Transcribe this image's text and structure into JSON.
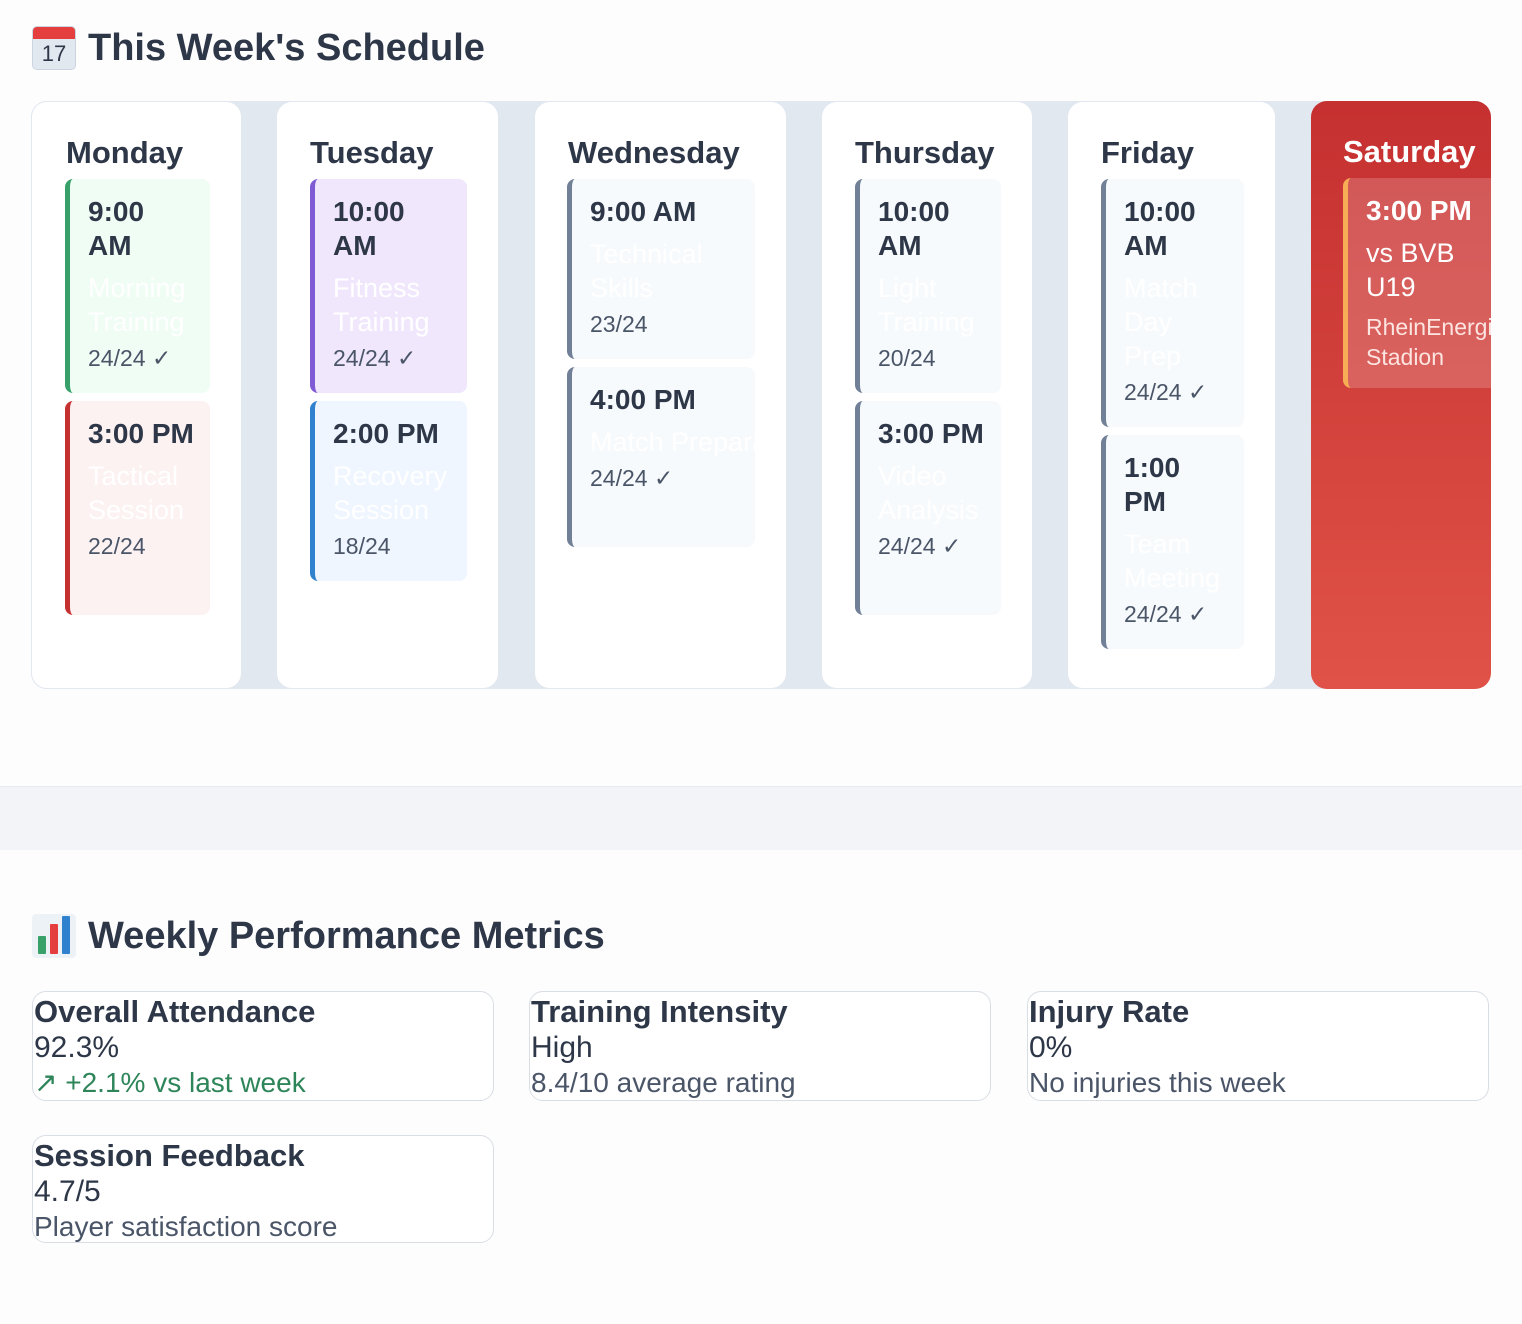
{
  "schedule": {
    "title": "This Week's Schedule",
    "icon": "calendar-icon",
    "icon_text": "17",
    "days": [
      {
        "name": "Monday",
        "sessions": [
          {
            "time": "9:00 AM",
            "title": "Morning Training",
            "count": "24/24 ✓",
            "bg": "#f0fdf4",
            "border": "#38a169"
          },
          {
            "time": "3:00 PM",
            "title": "Tactical Session",
            "count": "22/24",
            "bg": "#fdf2f2",
            "border": "#c53030"
          }
        ]
      },
      {
        "name": "Tuesday",
        "sessions": [
          {
            "time": "10:00 AM",
            "title": "Fitness Training",
            "count": "24/24 ✓",
            "bg": "#f0e7fd",
            "border": "#805ad5"
          },
          {
            "time": "2:00 PM",
            "title": "Recovery Session",
            "count": "18/24",
            "bg": "#eff6ff",
            "border": "#3182ce"
          }
        ]
      },
      {
        "name": "Wednesday",
        "sessions": [
          {
            "time": "9:00 AM",
            "title": "Technical Skills",
            "count": "23/24",
            "bg": "#f7fafc",
            "border": "#718096"
          },
          {
            "time": "4:00 PM",
            "title": "Match Preparation",
            "count": "24/24 ✓",
            "bg": "#f7fafc",
            "border": "#718096"
          }
        ]
      },
      {
        "name": "Thursday",
        "sessions": [
          {
            "time": "10:00 AM",
            "title": "Light Training",
            "count": "20/24",
            "bg": "#f7fafc",
            "border": "#718096"
          },
          {
            "time": "3:00 PM",
            "title": "Video Analysis",
            "count": "24/24 ✓",
            "bg": "#f7fafc",
            "border": "#718096"
          }
        ]
      },
      {
        "name": "Friday",
        "sessions": [
          {
            "time": "10:00 AM",
            "title": "Match Day Prep",
            "count": "24/24 ✓",
            "bg": "#f7fafc",
            "border": "#718096"
          },
          {
            "time": "1:00 PM",
            "title": "Team Meeting",
            "count": "24/24 ✓",
            "bg": "#f7fafc",
            "border": "#718096"
          }
        ]
      },
      {
        "name": "Saturday",
        "match": true,
        "sessions": [
          {
            "time": "3:00 PM",
            "title": "vs BVB U19",
            "venue": "RheinEnergieStadion"
          }
        ]
      }
    ]
  },
  "metrics": {
    "title": "Weekly Performance Metrics",
    "icon": "bar-chart-icon",
    "cards": [
      {
        "title": "Overall Attendance",
        "value": "92.3%",
        "sub": "↗ +2.1% vs last week",
        "positive": true
      },
      {
        "title": "Training Intensity",
        "value": "High",
        "sub": "8.4/10 average rating"
      },
      {
        "title": "Injury Rate",
        "value": "0%",
        "sub": "No injuries this week"
      },
      {
        "title": "Session Feedback",
        "value": "4.7/5",
        "sub": "Player satisfaction score"
      }
    ]
  }
}
